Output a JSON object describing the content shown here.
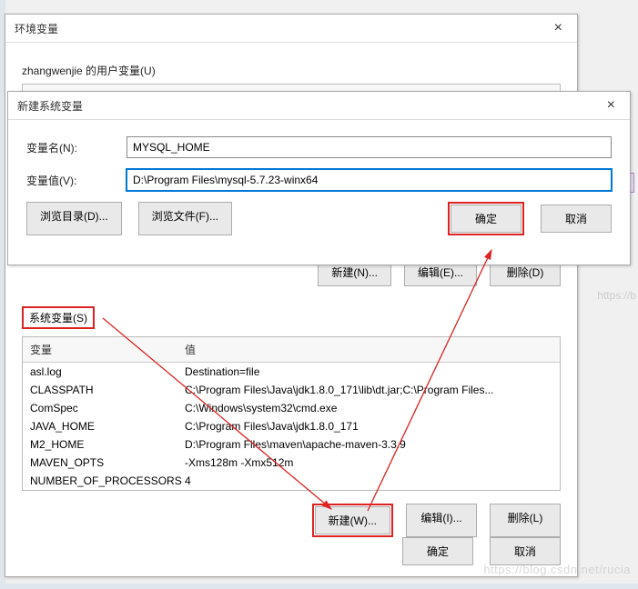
{
  "env_win": {
    "title": "环境变量",
    "user_section_label": "zhangwenjie 的用户变量(U)",
    "col_var": "变量",
    "col_val": "值",
    "user_buttons": {
      "new": "新建(N)...",
      "edit": "编辑(E)...",
      "del": "删除(D)"
    },
    "sys_section_label": "系统变量(S)",
    "sys_vars": [
      {
        "name": "asl.log",
        "value": "Destination=file"
      },
      {
        "name": "CLASSPATH",
        "value": "C:\\Program Files\\Java\\jdk1.8.0_171\\lib\\dt.jar;C:\\Program Files..."
      },
      {
        "name": "ComSpec",
        "value": "C:\\Windows\\system32\\cmd.exe"
      },
      {
        "name": "JAVA_HOME",
        "value": "C:\\Program Files\\Java\\jdk1.8.0_171"
      },
      {
        "name": "M2_HOME",
        "value": "D:\\Program Files\\maven\\apache-maven-3.3.9"
      },
      {
        "name": "MAVEN_OPTS",
        "value": " -Xms128m -Xmx512m"
      },
      {
        "name": "NUMBER_OF_PROCESSORS",
        "value": "4"
      }
    ],
    "sys_buttons": {
      "new": "新建(W)...",
      "edit": "编辑(I)...",
      "del": "删除(L)"
    },
    "final": {
      "ok": "确定",
      "cancel": "取消"
    }
  },
  "dlg": {
    "title": "新建系统变量",
    "name_label": "变量名(N):",
    "name_value": "MYSQL_HOME",
    "value_label": "变量值(V):",
    "value_value": "D:\\Program Files\\mysql-5.7.23-winx64",
    "browse_dir": "浏览目录(D)...",
    "browse_file": "浏览文件(F)...",
    "ok": "确定",
    "cancel": "取消"
  },
  "watermark": "https://blog.csdn.net/rucia",
  "rtext": "https://b"
}
